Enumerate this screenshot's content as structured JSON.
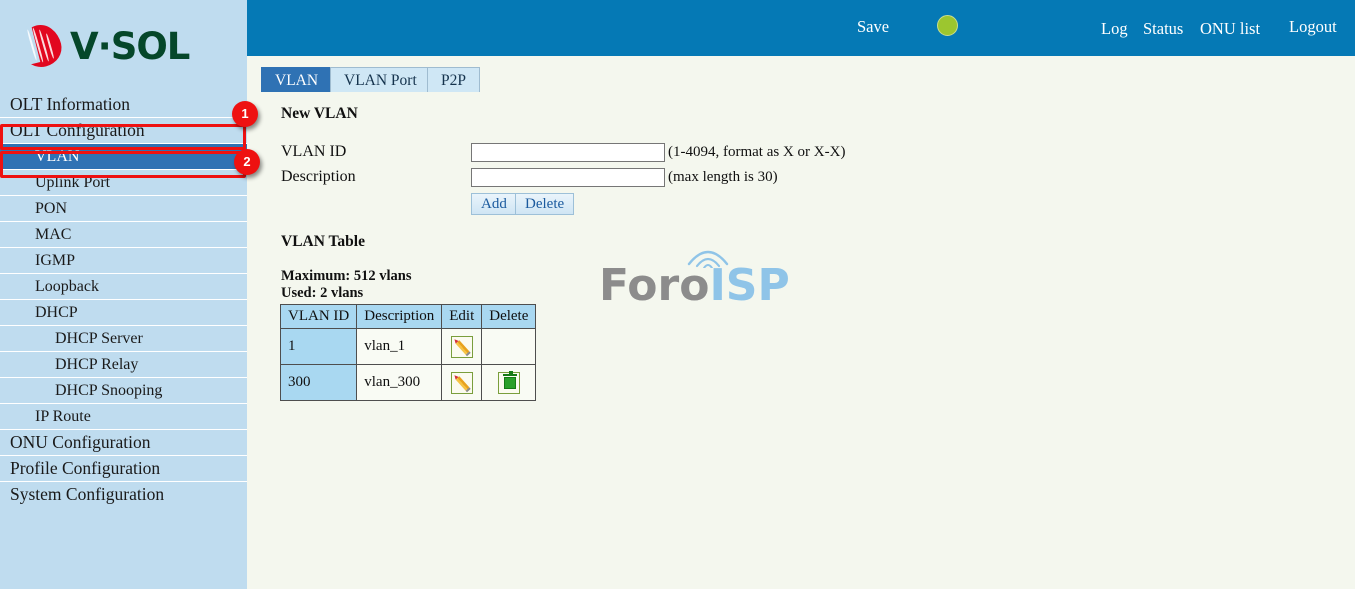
{
  "brand": {
    "name": "V·SOL",
    "logo_icon": "vsol-leaf-logo",
    "text_color": "#05472a",
    "mark_color": "#e2071f"
  },
  "topbar": {
    "background": "#0579b5",
    "save_label": "Save",
    "save_indicator_icon": "green-status-circle",
    "save_indicator_color": "#9cc62f",
    "log_label": "Log",
    "status_label": "Status",
    "onu_list_label": "ONU list",
    "logout_label": "Logout"
  },
  "tabs": [
    {
      "label": "VLAN",
      "active": true
    },
    {
      "label": "VLAN Port",
      "active": false
    },
    {
      "label": "P2P",
      "active": false
    }
  ],
  "sidebar": {
    "background": "#bfdcef",
    "selected_color": "#2f72b4",
    "items": [
      {
        "label": "OLT Information",
        "level": 1,
        "selected": false
      },
      {
        "label": "OLT Configuration",
        "level": 1,
        "selected": false
      },
      {
        "label": "VLAN",
        "level": 2,
        "selected": true
      },
      {
        "label": "Uplink Port",
        "level": 2,
        "selected": false
      },
      {
        "label": "PON",
        "level": 2,
        "selected": false
      },
      {
        "label": "MAC",
        "level": 2,
        "selected": false
      },
      {
        "label": "IGMP",
        "level": 2,
        "selected": false
      },
      {
        "label": "Loopback",
        "level": 2,
        "selected": false
      },
      {
        "label": "DHCP",
        "level": 2,
        "selected": false
      },
      {
        "label": "DHCP Server",
        "level": 3,
        "selected": false
      },
      {
        "label": "DHCP Relay",
        "level": 3,
        "selected": false
      },
      {
        "label": "DHCP Snooping",
        "level": 3,
        "selected": false
      },
      {
        "label": "IP Route",
        "level": 2,
        "selected": false
      },
      {
        "label": "ONU Configuration",
        "level": 1,
        "selected": false
      },
      {
        "label": "Profile Configuration",
        "level": 1,
        "selected": false
      },
      {
        "label": "System Configuration",
        "level": 1,
        "selected": false
      }
    ]
  },
  "annotations": {
    "color": "#ee1111",
    "badges": [
      {
        "number": "1",
        "target": "OLT Configuration"
      },
      {
        "number": "2",
        "target": "VLAN"
      }
    ]
  },
  "main": {
    "new_vlan": {
      "title": "New VLAN",
      "vlan_id_label": "VLAN ID",
      "vlan_id_value": "",
      "vlan_id_hint": "(1-4094, format as X or X-X)",
      "description_label": "Description",
      "description_value": "",
      "description_hint": "(max length is 30)",
      "add_label": "Add",
      "delete_label": "Delete"
    },
    "vlan_table": {
      "title": "VLAN Table",
      "maximum_text": "Maximum: 512 vlans",
      "used_text": "Used: 2 vlans",
      "headers": [
        "VLAN ID",
        "Description",
        "Edit",
        "Delete"
      ],
      "rows": [
        {
          "vlan_id": "1",
          "description": "vlan_1",
          "edit_icon": "pencil-edit-icon",
          "delete_icon": ""
        },
        {
          "vlan_id": "300",
          "description": "vlan_300",
          "edit_icon": "pencil-edit-icon",
          "delete_icon": "trash-delete-icon"
        }
      ]
    }
  },
  "watermark": {
    "text_primary": "Foro",
    "text_secondary": "ISP",
    "primary_color": "#8c8c8c",
    "secondary_color": "#8fc4e8",
    "signal_icon": "wifi-signal-arc-icon"
  }
}
